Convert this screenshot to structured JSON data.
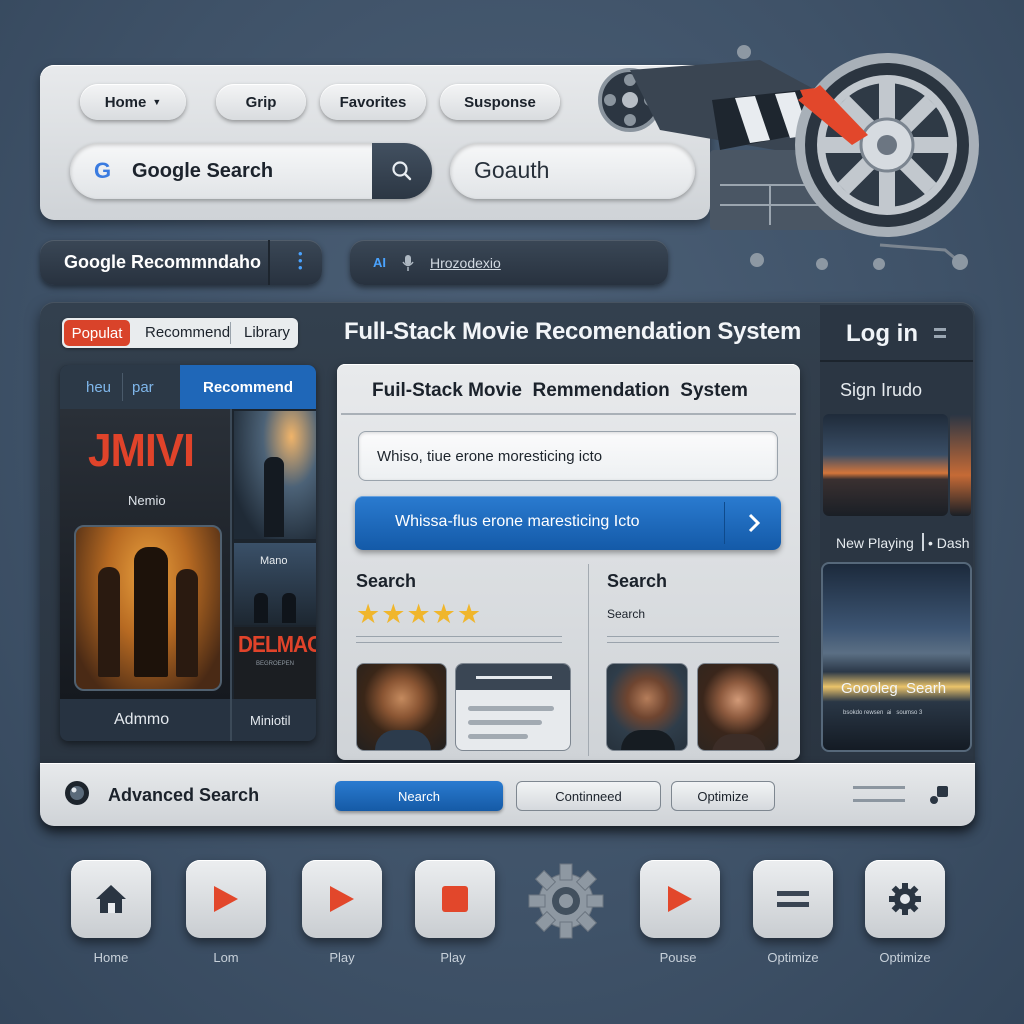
{
  "nav": {
    "items": [
      "Home",
      "Grip",
      "Favorites",
      "Susponse"
    ],
    "search_label": "Google Search",
    "search_g": "G",
    "secondary_field": "Goauth"
  },
  "second_row": {
    "google_rec": "Google Recommndaho",
    "ai_tag": "AI",
    "search_text": "Hrozodexio"
  },
  "main": {
    "title": "Full-Stack Movie Recomendation System",
    "tabs": [
      "Populat",
      "Recommend",
      "Library"
    ],
    "left_tabs": [
      "heu",
      "par",
      "Recommend"
    ],
    "poster_title": "JMIVI",
    "poster_sub": "Nemio",
    "thumb_mano": "Mano",
    "thumb_delmao": "DELMAO",
    "thumb_delmao_sub": "BEGROEPEN",
    "left_footer": [
      "Admmo",
      "Miniotil"
    ],
    "center_title": "Fuil-Stack Movie  Remmendation  System",
    "input_text": "Whiso, tiue erone moresticing icto",
    "primary_button": "Whissa-flus erone maresticing Icto",
    "search_heading_left": "Search",
    "rating": 5,
    "search_heading_right": "Search",
    "search_sub_right": "Search",
    "login": "Log in",
    "signin": "Sign Irudo",
    "now_playing": "New Playing",
    "dash": "• Dash",
    "right_card_title": "Goooleg  Searh",
    "right_card_sub": "bsokdo rewsen  ai   soumso 3"
  },
  "advanced": {
    "label": "Advanced Search",
    "buttons": [
      "Nearch",
      "Continneed",
      "Optimize"
    ]
  },
  "bottom_buttons": [
    {
      "label": "Home",
      "icon": "home-icon"
    },
    {
      "label": "Lom",
      "icon": "play-icon"
    },
    {
      "label": "Play",
      "icon": "play-icon"
    },
    {
      "label": "Play",
      "icon": "stop-icon"
    },
    {
      "label": "Pouse",
      "icon": "play-icon"
    },
    {
      "label": "Optimize",
      "icon": "menu-icon"
    },
    {
      "label": "Optimize",
      "icon": "gear-icon"
    }
  ],
  "colors": {
    "accent_blue": "#1f67b8",
    "accent_red": "#e2472b",
    "background": "#3f5268"
  }
}
